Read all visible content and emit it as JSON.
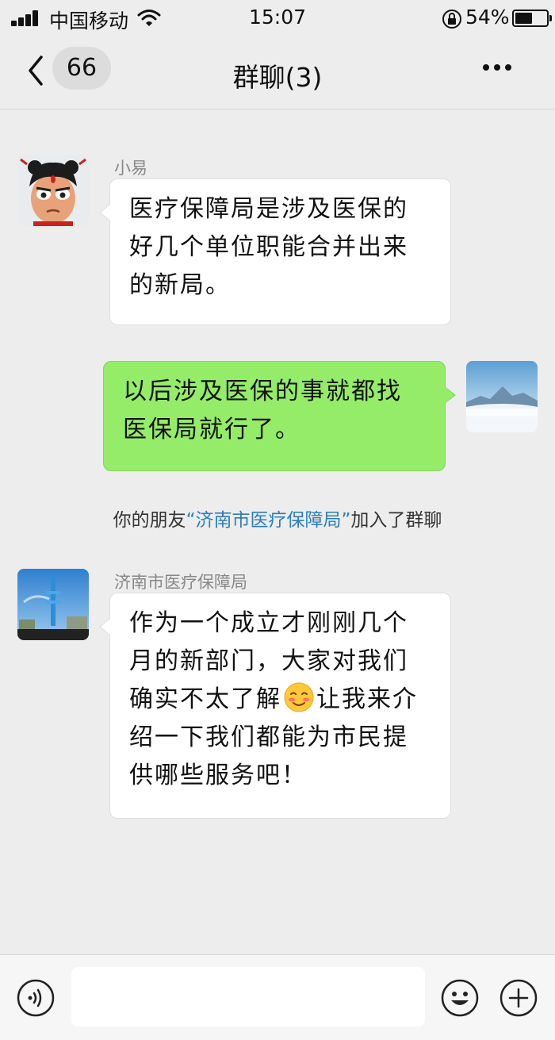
{
  "status_bar": {
    "carrier": "中国移动",
    "time": "15:07",
    "battery_percent_text": "54%",
    "battery_level": 0.54
  },
  "nav": {
    "unread_count": "66",
    "title": "群聊(3)"
  },
  "messages": [
    {
      "sender": "小易",
      "side": "left",
      "text": "医疗保障局是涉及医保的好几个单位职能合并出来的新局。"
    },
    {
      "side": "right",
      "text": "以后涉及医保的事就都找医保局就行了。"
    },
    {
      "sender": "济南市医疗保障局",
      "side": "left",
      "text_before_emoji": "作为一个成立才刚刚几个月的新部门，大家对我们确实不太了解",
      "emoji": "blushing-emoji",
      "text_after_emoji": "让我来介绍一下我们都能为市民提供哪些服务吧！"
    }
  ],
  "system_message": {
    "prefix": "你的朋友",
    "highlight": "“济南市医疗保障局”",
    "suffix": "加入了群聊"
  },
  "colors": {
    "background": "#ededed",
    "bubble_self": "#95ec69",
    "bubble_other": "#ffffff",
    "link": "#2b7fb8"
  },
  "icons": [
    "signal-icon",
    "wifi-icon",
    "lock-rotation-icon",
    "battery-icon",
    "back-chevron-icon",
    "more-icon",
    "voice-icon",
    "emoji-icon",
    "plus-icon"
  ]
}
